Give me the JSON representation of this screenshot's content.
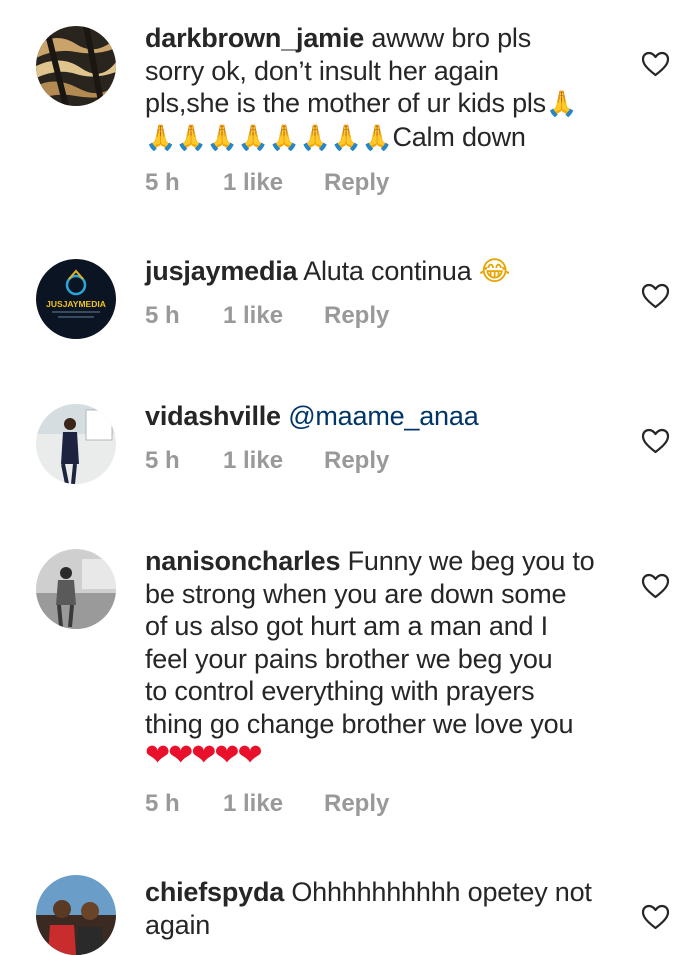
{
  "comments": [
    {
      "username": "darkbrown_jamie",
      "text_lines": [
        " awww bro pls",
        "sorry ok, don’t insult her again",
        "pls,she is the mother of ur kids pls"
      ],
      "pray_first": "🙏",
      "pray_row": "🙏🙏🙏🙏🙏🙏🙏🙏",
      "tail": "Calm down",
      "time": "5 h",
      "likes": "1 like",
      "reply": "Reply"
    },
    {
      "username": "jusjaymedia",
      "text": " Aluta continua ",
      "emoji": "😂",
      "avatar_text": "JUSJAYMEDIA",
      "time": "5 h",
      "likes": "1 like",
      "reply": "Reply"
    },
    {
      "username": "vidashville",
      "mention": "@maame_anaa",
      "time": "5 h",
      "likes": "1 like",
      "reply": "Reply"
    },
    {
      "username": "nanisoncharles",
      "text_lines": [
        " Funny we beg you to",
        "be strong when you are down some",
        "of us also got hurt am a man and I",
        "feel your pains brother we beg you",
        "to control everything with prayers",
        "thing go change brother we love you"
      ],
      "hearts": "❤❤❤❤❤",
      "time": "5 h",
      "likes": "1 like",
      "reply": "Reply"
    },
    {
      "username": "chiefspyda",
      "text_lines": [
        " Ohhhhhhhhhh opetey not",
        "again"
      ]
    }
  ],
  "icons": {
    "like": "heart-outline-icon"
  },
  "colors": {
    "text": "#262626",
    "meta": "#999999",
    "mention": "#003569"
  }
}
